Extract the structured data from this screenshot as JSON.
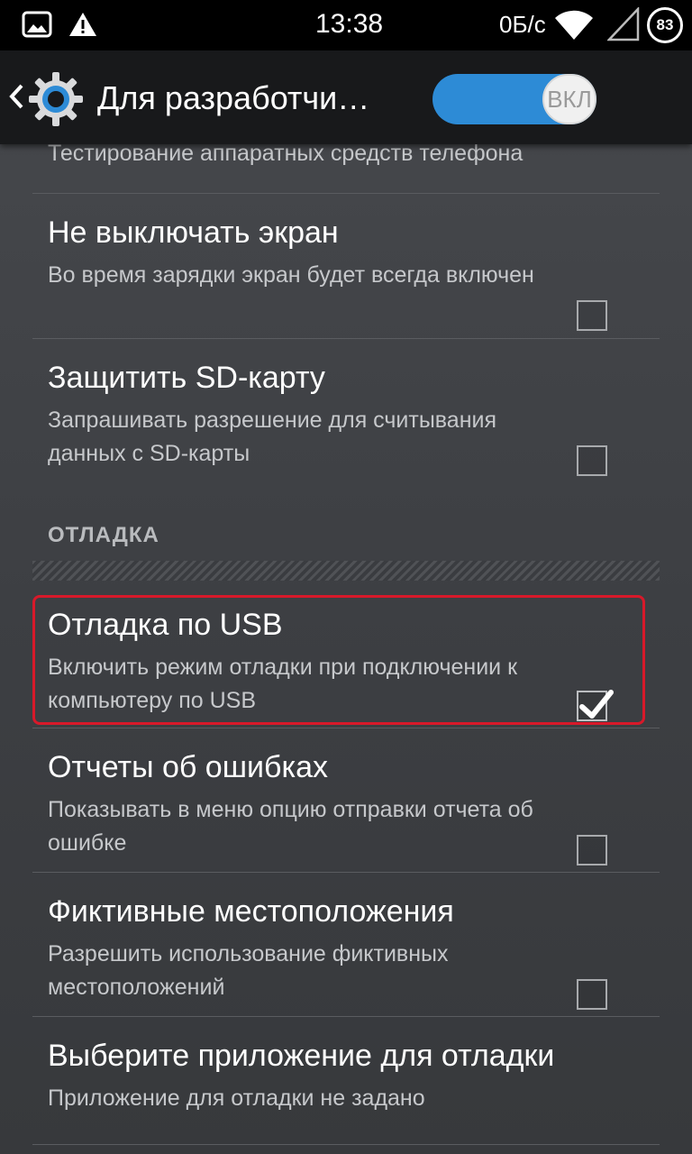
{
  "status_bar": {
    "time": "13:38",
    "data_rate": "0Б/с",
    "battery": "83",
    "icons": [
      "gallery-icon",
      "warning-icon",
      "wifi-icon",
      "signal-icon",
      "battery-icon"
    ]
  },
  "app_bar": {
    "title": "Для разработчи…",
    "toggle_label": "ВКЛ",
    "toggle_on": true,
    "accent_color": "#2d8bd6"
  },
  "top_partial_summary": "Тестирование аппаратных средств телефона",
  "section_header": "ОТЛАДКА",
  "prefs": [
    {
      "title": "Не выключать экран",
      "summary": "Во время зарядки экран будет всегда включен",
      "checked": false
    },
    {
      "title": "Защитить SD-карту",
      "summary": "Запрашивать разрешение для считывания данных с SD-карты",
      "checked": false
    },
    {
      "title": "Отладка по USB",
      "summary": "Включить режим отладки при подключении к компьютеру по USB",
      "checked": true
    },
    {
      "title": "Отчеты об ошибках",
      "summary": "Показывать в меню опцию отправки отчета об ошибке",
      "checked": false
    },
    {
      "title": "Фиктивные местоположения",
      "summary": "Разрешить использование фиктивных местоположений",
      "checked": false
    },
    {
      "title": "Выберите приложение для отладки",
      "summary": "Приложение для отладки не задано"
    }
  ],
  "highlight_color": "#d8192a"
}
